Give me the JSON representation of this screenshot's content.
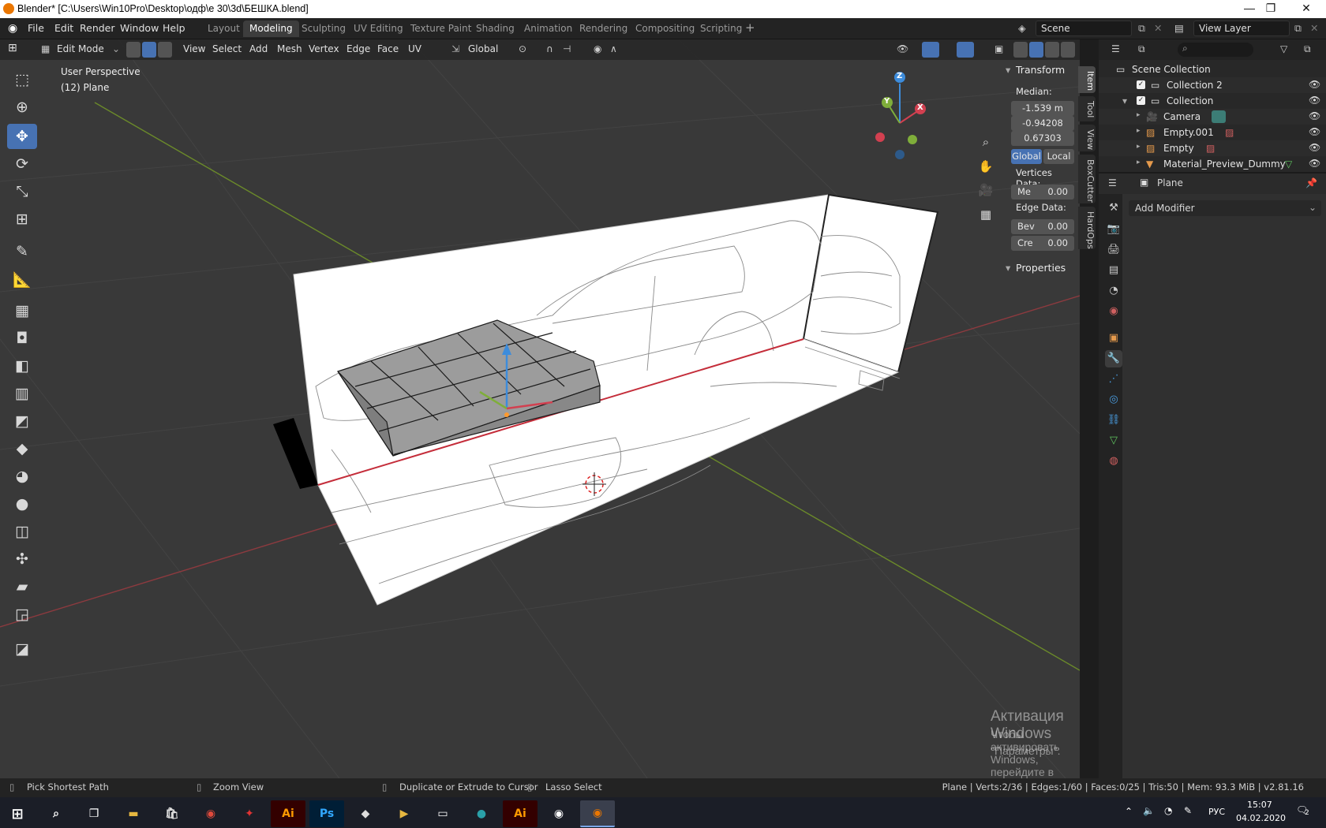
{
  "window": {
    "title": "Blender* [C:\\Users\\Win10Pro\\Desktop\\одф\\е 30\\3d\\БЕШКА.blend]",
    "controls": [
      "—",
      "❐",
      "✕"
    ]
  },
  "menu": [
    "File",
    "Edit",
    "Render",
    "Window",
    "Help"
  ],
  "workspaces": [
    "Layout",
    "Modeling",
    "Sculpting",
    "UV Editing",
    "Texture Paint",
    "Shading",
    "Animation",
    "Rendering",
    "Compositing",
    "Scripting"
  ],
  "active_workspace": "Modeling",
  "scene_field": "Scene",
  "view_layer_field": "View Layer",
  "viewport": {
    "mode": "Edit Mode",
    "header_menus": [
      "View",
      "Select",
      "Add",
      "Mesh",
      "Vertex",
      "Edge",
      "Face",
      "UV"
    ],
    "orientation": "Global",
    "perspective_label": "User Perspective",
    "object_label": "(12) Plane",
    "gizmo_axes": [
      "Z",
      "Y",
      "X"
    ]
  },
  "npanel": {
    "transform_title": "Transform",
    "median_label": "Median:",
    "median": [
      "-1.539 m",
      "-0.94208",
      "0.67303"
    ],
    "global_label": "Global",
    "local_label": "Local",
    "vertices_data_label": "Vertices Data:",
    "vertices_me": "Me",
    "vertices_me_val": "0.00",
    "edge_data_label": "Edge Data:",
    "edge_bev": "Bev",
    "edge_bev_val": "0.00",
    "edge_cre": "Cre",
    "edge_cre_val": "0.00",
    "properties_title": "Properties",
    "tabs": [
      "Item",
      "Tool",
      "View",
      "BoxCutter",
      "HardOps"
    ]
  },
  "outliner": {
    "root": "Scene Collection",
    "items": [
      "Collection 2",
      "Collection",
      "Camera",
      "Empty.001",
      "Empty",
      "Material_Preview_Dummy"
    ]
  },
  "properties": {
    "object_name": "Plane",
    "add_modifier": "Add Modifier"
  },
  "status": {
    "left1": "Pick Shortest Path",
    "left2": "Zoom View",
    "left3": "Duplicate or Extrude to Cursor",
    "left4": "Lasso Select",
    "right": "Plane | Verts:2/36 | Edges:1/60 | Faces:0/25 | Tris:50 | Mem: 93.3 MiB | v2.81.16"
  },
  "watermark": {
    "line1": "Активация Windows",
    "line2": "Чтобы активировать Windows, перейдите в раздел",
    "line3": "\"Параметры\"."
  },
  "taskbar": {
    "apps": [
      "Ai",
      "Ps",
      "Ai"
    ],
    "lang": "РУС",
    "time": "15:07",
    "date": "04.02.2020",
    "notif": "2"
  }
}
